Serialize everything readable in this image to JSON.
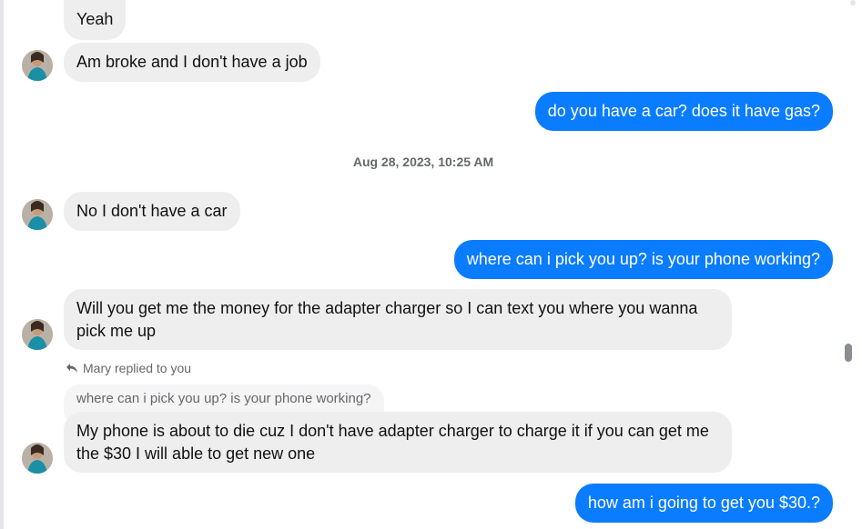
{
  "messages": {
    "m1": "Yeah",
    "m2": "Am broke and I don't have a job",
    "m3": "do you have a car?  does it have gas?",
    "m4": "No I don't have a car",
    "m5": "where can i pick you up?  is your phone working?",
    "m6": "Will you get me the money for the adapter charger so I can text you where you wanna pick me up",
    "m7": "My phone is about to die cuz I don't have adapter charger to charge it if you can get me the $30 I will able to get new one",
    "m8": "how am i going to get you $30.?"
  },
  "timestamp": "Aug 28, 2023, 10:25 AM",
  "reply": {
    "note": "Mary replied to you",
    "quoted_text": "where can i pick you up?  is your phone working?"
  },
  "colors": {
    "outgoing_bubble": "#0a7cff",
    "incoming_bubble": "#eeeeee"
  },
  "icons": {
    "reply": "reply-arrow-icon",
    "avatar": "contact-avatar"
  }
}
